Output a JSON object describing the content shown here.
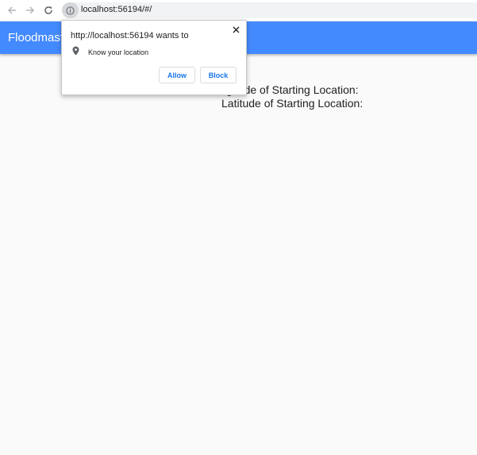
{
  "browser": {
    "url": "localhost:56194/#/",
    "icons": [
      "back-arrow-icon",
      "forward-arrow-icon",
      "reload-icon",
      "info-icon"
    ]
  },
  "app_bar": {
    "title": "Floodmast",
    "color": "#448aff"
  },
  "content": {
    "longitude_line": "gitude of Starting Location:",
    "latitude_line": "Latitude of Starting Location:"
  },
  "permission_popup": {
    "heading": "http://localhost:56194 wants to",
    "permission_label": "Know your location",
    "permission_icon": "location-pin-icon",
    "allow_label": "Allow",
    "block_label": "Block",
    "button_text_color": "#1a73e8"
  }
}
